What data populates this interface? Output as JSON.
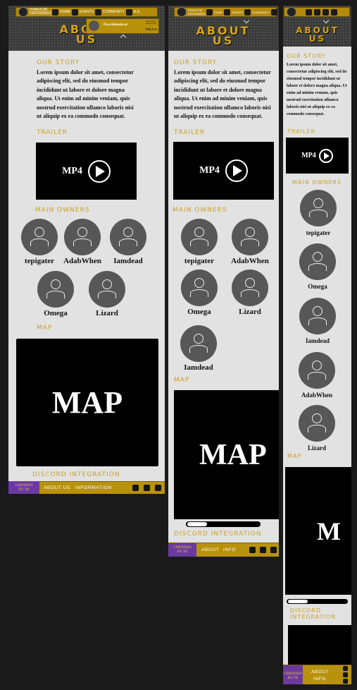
{
  "site": {
    "brand": "PHANTOM DEFENDERS"
  },
  "nav": {
    "home": "HOME",
    "events": "EVENTS",
    "community": "COMMUNITY",
    "ag": "A.G."
  },
  "user": {
    "name": "PacoAlmodovar",
    "rank": "P.R.A.S.",
    "note": "Lorem ipsum dolor sit amet"
  },
  "page": {
    "title_line1": "ABOUT",
    "title_line2": "US"
  },
  "story": {
    "heading": "OUR STORY",
    "text": "Lorem ipsum dolor sit amet, consectetur adipiscing elit, sed do eiusmod tempor incididunt ut labore et dolore magna aliqua. Ut enim ad minim veniam, quis nostrud exercitation ullamco laboris nisi ut aliquip ex ea commodo consequat."
  },
  "trailer": {
    "heading": "TRAILER",
    "label": "MP4"
  },
  "owners": {
    "heading": "MAIN OWNERS",
    "desktop": [
      "tepigater",
      "AdabWhen",
      "Iamdead",
      "Omega",
      "Lizard"
    ],
    "mobile": [
      "tepigater",
      "Omega",
      "Iamdead",
      "AdabWhen",
      "Lizard"
    ]
  },
  "map": {
    "heading": "MAP",
    "label": "MAP",
    "mobile_label": "M"
  },
  "discord": {
    "heading": "DISCORD INTEGRATION",
    "line1": "DISCORD",
    "line2": "INTEGRATION"
  },
  "footer": {
    "cert_line1": "CERTIFIED",
    "cert_line2": "BY TR",
    "about": "ABOUT US",
    "information": "INFORMATION",
    "about_short": "ABOUT",
    "info_short": "INFO"
  }
}
